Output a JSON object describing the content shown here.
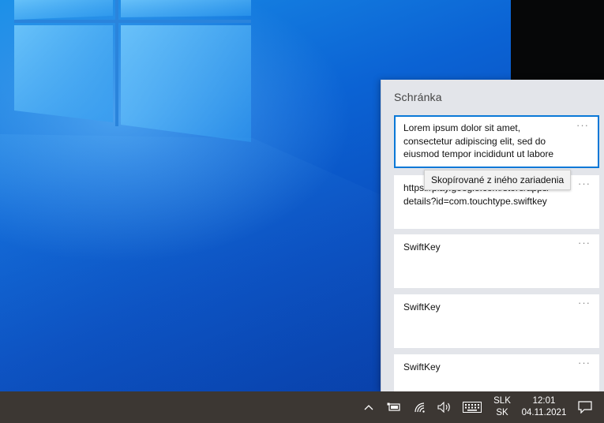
{
  "clipboard": {
    "title": "Schránka",
    "more_label": "···",
    "items": [
      {
        "text": "Lorem ipsum dolor sit amet,\nconsectetur adipiscing elit, sed do\neiusmod tempor incididunt ut labore"
      },
      {
        "text": "https://play.google.com/store/apps/\ndetails?id=com.touchtype.swiftkey"
      },
      {
        "text": "SwiftKey"
      },
      {
        "text": "SwiftKey"
      },
      {
        "text": "SwiftKey"
      }
    ],
    "tooltip": "Skopírované z iného zariadenia"
  },
  "taskbar": {
    "lang_line1": "SLK",
    "lang_line2": "SK",
    "time": "12:01",
    "date": "04.11.2021",
    "icons": [
      "chevron-up-icon",
      "battery-icon",
      "wifi-icon",
      "volume-icon",
      "keyboard-icon",
      "notification-icon"
    ]
  },
  "colors": {
    "accent": "#0a78d7",
    "taskbar": "#3c3733",
    "panel": "#e3e5ea"
  }
}
